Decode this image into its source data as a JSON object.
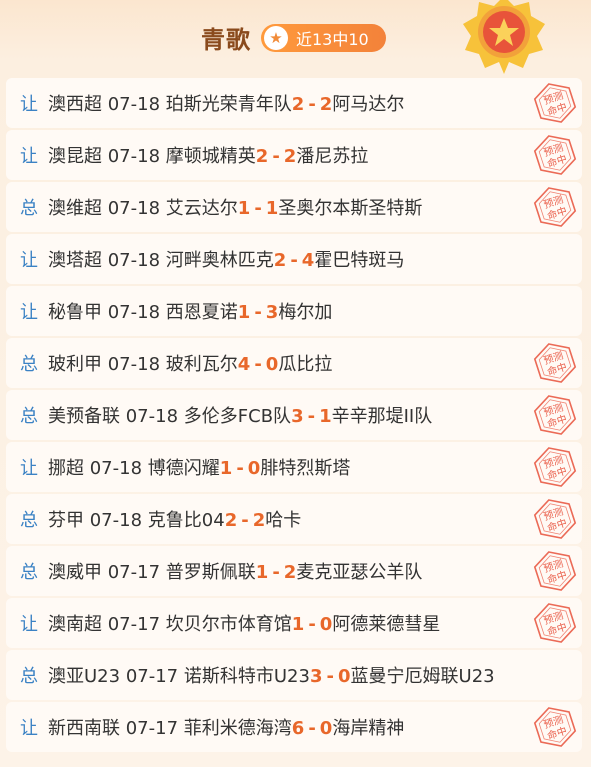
{
  "header": {
    "title": "青歌",
    "record": "近13中10"
  },
  "matches": [
    {
      "type": "让",
      "league": "澳西超",
      "date": "07-18",
      "home": "珀斯光荣青年队",
      "hs": "2",
      "as": "2",
      "away": "阿马达尔",
      "hit": true
    },
    {
      "type": "让",
      "league": "澳昆超",
      "date": "07-18",
      "home": "摩顿城精英",
      "hs": "2",
      "as": "2",
      "away": "潘尼苏拉",
      "hit": true
    },
    {
      "type": "总",
      "league": "澳维超",
      "date": "07-18",
      "home": "艾云达尔",
      "hs": "1",
      "as": "1",
      "away": "圣奥尔本斯圣特斯",
      "hit": true
    },
    {
      "type": "让",
      "league": "澳塔超",
      "date": "07-18",
      "home": "河畔奥林匹克",
      "hs": "2",
      "as": "4",
      "away": "霍巴特斑马",
      "hit": false
    },
    {
      "type": "让",
      "league": "秘鲁甲",
      "date": "07-18",
      "home": "西恩夏诺",
      "hs": "1",
      "as": "3",
      "away": "梅尔加",
      "hit": false
    },
    {
      "type": "总",
      "league": "玻利甲",
      "date": "07-18",
      "home": "玻利瓦尔",
      "hs": "4",
      "as": "0",
      "away": "瓜比拉",
      "hit": true
    },
    {
      "type": "总",
      "league": "美预备联",
      "date": "07-18",
      "home": "多伦多FCB队",
      "hs": "3",
      "as": "1",
      "away": "辛辛那堤II队",
      "hit": true
    },
    {
      "type": "让",
      "league": "挪超",
      "date": "07-18",
      "home": "博德闪耀",
      "hs": "1",
      "as": "0",
      "away": "腓特烈斯塔",
      "hit": true
    },
    {
      "type": "总",
      "league": "芬甲",
      "date": "07-18",
      "home": "克鲁比04",
      "hs": "2",
      "as": "2",
      "away": "哈卡",
      "hit": true
    },
    {
      "type": "总",
      "league": "澳威甲",
      "date": "07-17",
      "home": "普罗斯佩联",
      "hs": "1",
      "as": "2",
      "away": "麦克亚瑟公羊队",
      "hit": true
    },
    {
      "type": "让",
      "league": "澳南超",
      "date": "07-17",
      "home": "坎贝尔市体育馆",
      "hs": "1",
      "as": "0",
      "away": "阿德莱德彗星",
      "hit": true
    },
    {
      "type": "总",
      "league": "澳亚U23",
      "date": "07-17",
      "home": "诺斯科特市U23",
      "hs": "3",
      "as": "0",
      "away": "蓝曼宁厄姆联U23",
      "hit": false
    },
    {
      "type": "让",
      "league": "新西南联",
      "date": "07-17",
      "home": "菲利米德海湾",
      "hs": "6",
      "as": "0",
      "away": "海岸精神",
      "hit": true
    }
  ],
  "stamp": {
    "line1": "预测",
    "line2": "命中",
    "color": "#e8503a"
  },
  "colors": {
    "score": "#e8672a",
    "tag": "#3b82c4",
    "title": "#8a4a1c"
  }
}
